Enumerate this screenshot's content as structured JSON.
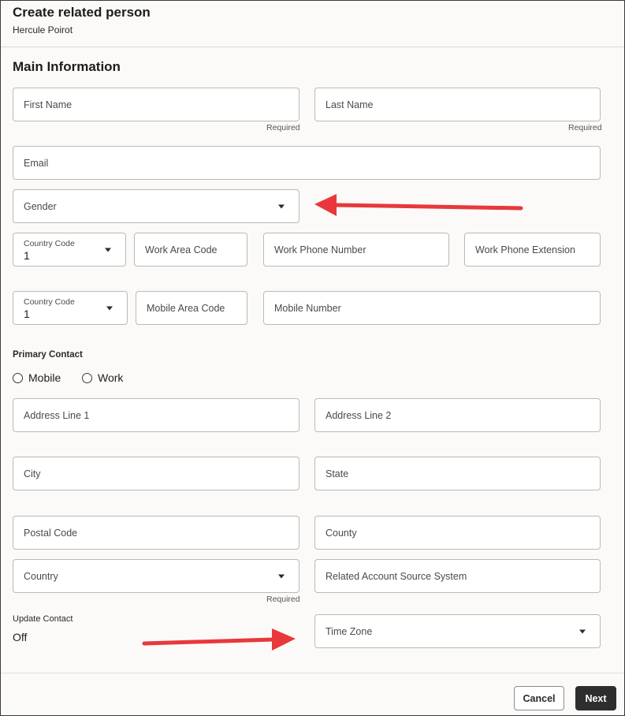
{
  "header": {
    "title": "Create related person",
    "subtitle": "Hercule Poirot"
  },
  "section": {
    "title": "Main Information"
  },
  "fields": {
    "first_name": "First Name",
    "last_name": "Last Name",
    "email": "Email",
    "gender": "Gender",
    "country_code_label": "Country Code",
    "country_code_value": "1",
    "work_area_code": "Work Area Code",
    "work_phone_number": "Work Phone Number",
    "work_phone_extension": "Work Phone Extension",
    "mobile_country_code_label": "Country Code",
    "mobile_country_code_value": "1",
    "mobile_area_code": "Mobile Area Code",
    "mobile_number": "Mobile Number",
    "address_line_1": "Address Line 1",
    "address_line_2": "Address Line 2",
    "city": "City",
    "state": "State",
    "postal_code": "Postal Code",
    "county": "County",
    "country": "Country",
    "related_account_source_system": "Related Account Source System",
    "time_zone": "Time Zone"
  },
  "required_text": "Required",
  "primary_contact": {
    "label": "Primary Contact",
    "options": [
      "Mobile",
      "Work"
    ]
  },
  "update_contact": {
    "label": "Update Contact",
    "value": "Off"
  },
  "footer": {
    "cancel_label": "Cancel",
    "next_label": "Next"
  },
  "colors": {
    "arrow": "#e8383b",
    "next_button": "#2e2e2e"
  }
}
